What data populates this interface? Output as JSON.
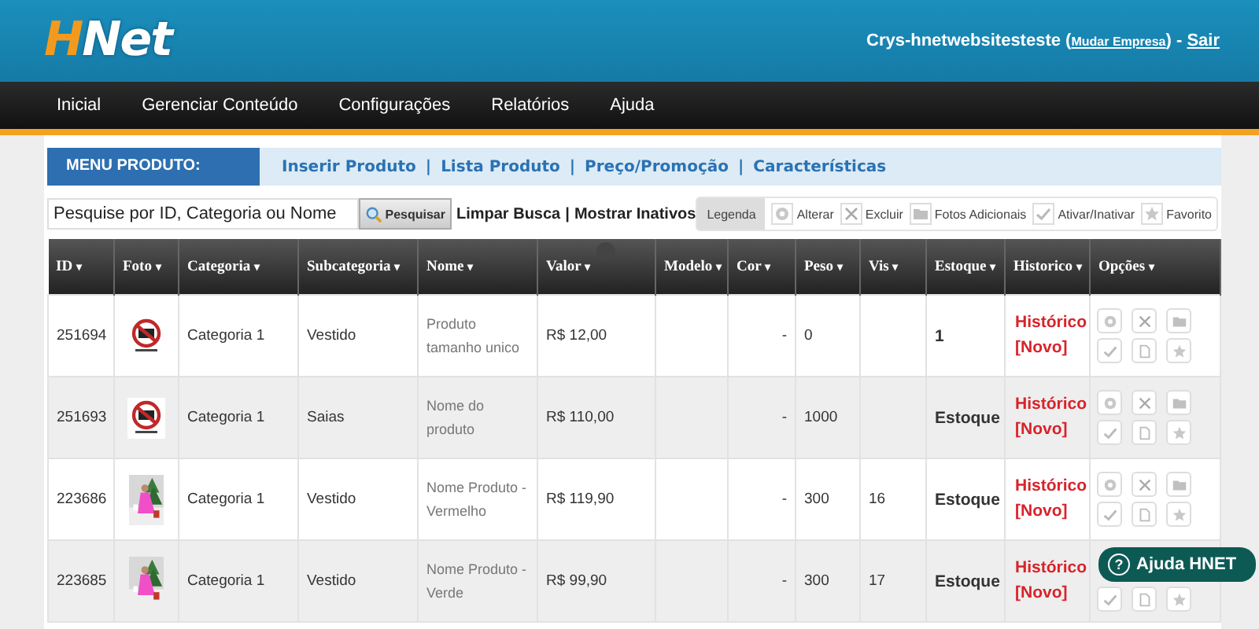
{
  "logo": {
    "accent": "H",
    "rest": "Net"
  },
  "user": {
    "name": "Crys-hnetwebsitesteste (",
    "change_link": "Mudar Empresa",
    "between": ") -",
    "logout": "Sair"
  },
  "nav": [
    "Inicial",
    "Gerenciar Conteúdo",
    "Configurações",
    "Relatórios",
    "Ajuda"
  ],
  "product_menu": {
    "title": "MENU PRODUTO:",
    "separator": "|",
    "links": [
      "Inserir Produto",
      "Lista Produto",
      "Preço/Promoção",
      "Características"
    ]
  },
  "search": {
    "placeholder": "Pesquise por ID, Categoria ou Nome",
    "button": "Pesquisar",
    "separator": "|",
    "links": [
      "Limpar Busca",
      "Mostrar Inativos"
    ]
  },
  "legend": {
    "title": "Legenda",
    "items": [
      {
        "kind": "gear",
        "label": "Alterar"
      },
      {
        "kind": "close",
        "label": "Excluir"
      },
      {
        "kind": "folder",
        "label": "Fotos Adicionais"
      },
      {
        "kind": "check",
        "label": "Ativar/Inativar"
      },
      {
        "kind": "star",
        "label": "Favorito"
      }
    ]
  },
  "table": {
    "columns": [
      {
        "label": "ID",
        "sort": "▾"
      },
      {
        "label": "Foto",
        "sort": "▾"
      },
      {
        "label": "Categoria",
        "sort": "▾"
      },
      {
        "label": "Subcategoria",
        "sort": "▾"
      },
      {
        "label": "Nome",
        "sort": "▾"
      },
      {
        "label": "Valor",
        "sort": "▾"
      },
      {
        "label": "Modelo",
        "sort": "▾"
      },
      {
        "label": "Cor",
        "sort": "▾"
      },
      {
        "label": "Peso",
        "sort": "▾"
      },
      {
        "label": "Vis",
        "sort": "▾"
      },
      {
        "label": "Estoque",
        "sort": "▾"
      },
      {
        "label": "Historico",
        "sort": "▾"
      },
      {
        "label": "Opções",
        "sort": "▾"
      }
    ],
    "rows": [
      {
        "id": "251694",
        "photo": {
          "kind": "no-photo"
        },
        "category": "Categoria 1",
        "subcategory": "Vestido",
        "name": "Produto tamanho unico",
        "value": "R$ 12,00",
        "cor": "-",
        "weight": "0",
        "stock": "1",
        "history": "Histórico",
        "history_new": "[Novo]"
      },
      {
        "id": "251693",
        "photo": {
          "kind": "no-photo"
        },
        "category": "Categoria 1",
        "subcategory": "Saias",
        "name": "Nome do produto",
        "value": "R$ 110,00",
        "cor": "-",
        "weight": "1000",
        "stock": "Estoque",
        "history": "Histórico",
        "history_new": "[Novo]"
      },
      {
        "id": "223686",
        "category": "Categoria 1",
        "subcategory": "Vestido",
        "name": "Nome Produto - Vermelho",
        "value": "R$ 119,90",
        "cor": "-",
        "weight": "300",
        "views": "16",
        "stock": "Estoque",
        "history": "Histórico",
        "history_new": "[Novo]"
      },
      {
        "id": "223685",
        "category": "Categoria 1",
        "subcategory": "Vestido",
        "name": "Nome Produto - Verde",
        "value": "R$ 99,90",
        "cor": "-",
        "weight": "300",
        "views": "17",
        "stock": "Estoque",
        "history": "Histórico",
        "history_new": "[Novo]"
      }
    ]
  },
  "help_button": {
    "icon": "?",
    "label": "Ajuda HNET"
  }
}
